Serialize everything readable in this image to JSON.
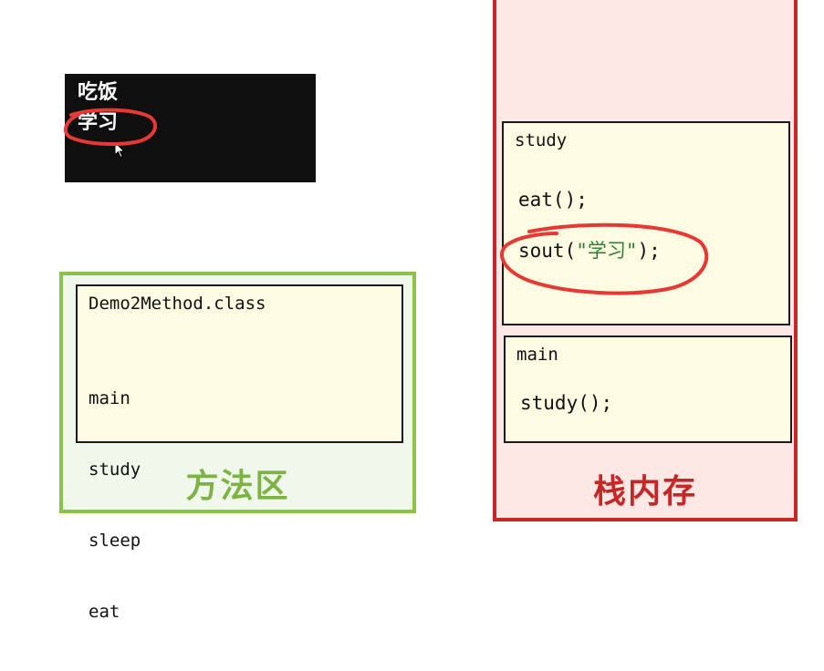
{
  "console": {
    "lines": [
      "吃饭",
      "学习"
    ]
  },
  "method_area": {
    "label": "方法区",
    "class_name": "Demo2Method.class",
    "methods": [
      "main",
      "study",
      "sleep",
      "eat"
    ]
  },
  "stack_memory": {
    "label": "栈内存",
    "frames": [
      {
        "name": "study",
        "code1": "eat();",
        "code2_pre": "sout(",
        "code2_str": "\"学习\"",
        "code2_post": ");"
      },
      {
        "name": "main",
        "code1": "study();"
      }
    ]
  },
  "colors": {
    "method_area_border": "#8bc34a",
    "stack_border": "#c62828",
    "stack_bg": "#fde8e6",
    "frame_bg": "#fefbe3",
    "annotation": "#e53935"
  }
}
